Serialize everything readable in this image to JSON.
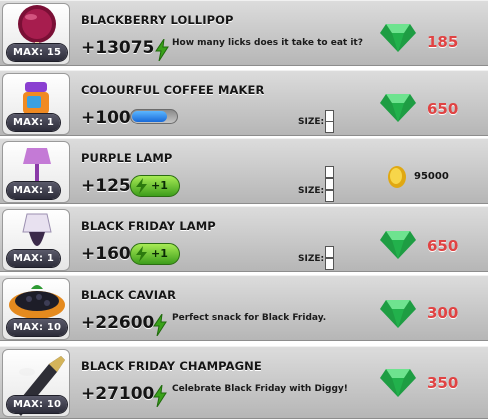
{
  "items": [
    {
      "name": "BLACKBERRY LOLLIPOP",
      "max": "MAX: 15",
      "energy": "+13075",
      "desc": "How many licks does it take to eat it?",
      "price": "185",
      "currency": "gem-icon"
    },
    {
      "name": "COLOURFUL COFFEE MAKER",
      "max": "MAX: 1",
      "energy": "+1000",
      "size_label": "SIZE:",
      "progress": 0.75,
      "price": "650",
      "currency": "gem-icon"
    },
    {
      "name": "PURPLE LAMP",
      "max": "MAX: 1",
      "energy": "+125",
      "boost": "+1",
      "size_label": "SIZE:",
      "price": "95000",
      "currency": "coin-icon"
    },
    {
      "name": "BLACK FRIDAY LAMP",
      "max": "MAX: 1",
      "energy": "+160",
      "boost": "+1",
      "size_label": "SIZE:",
      "price": "650",
      "currency": "gem-icon"
    },
    {
      "name": "BLACK CAVIAR",
      "max": "MAX: 10",
      "energy": "+22600",
      "desc": "Perfect snack for Black Friday.",
      "price": "300",
      "currency": "gem-icon"
    },
    {
      "name": "BLACK FRIDAY CHAMPAGNE",
      "max": "MAX: 10",
      "energy": "+27100",
      "desc": "Celebrate Black Friday with Diggy!",
      "price": "350",
      "currency": "gem-icon"
    }
  ],
  "colors": {
    "price": "#e04343",
    "gem": "#22b14c",
    "energy_bolt": "#3aa21a",
    "progress": "#2a7fe8"
  }
}
